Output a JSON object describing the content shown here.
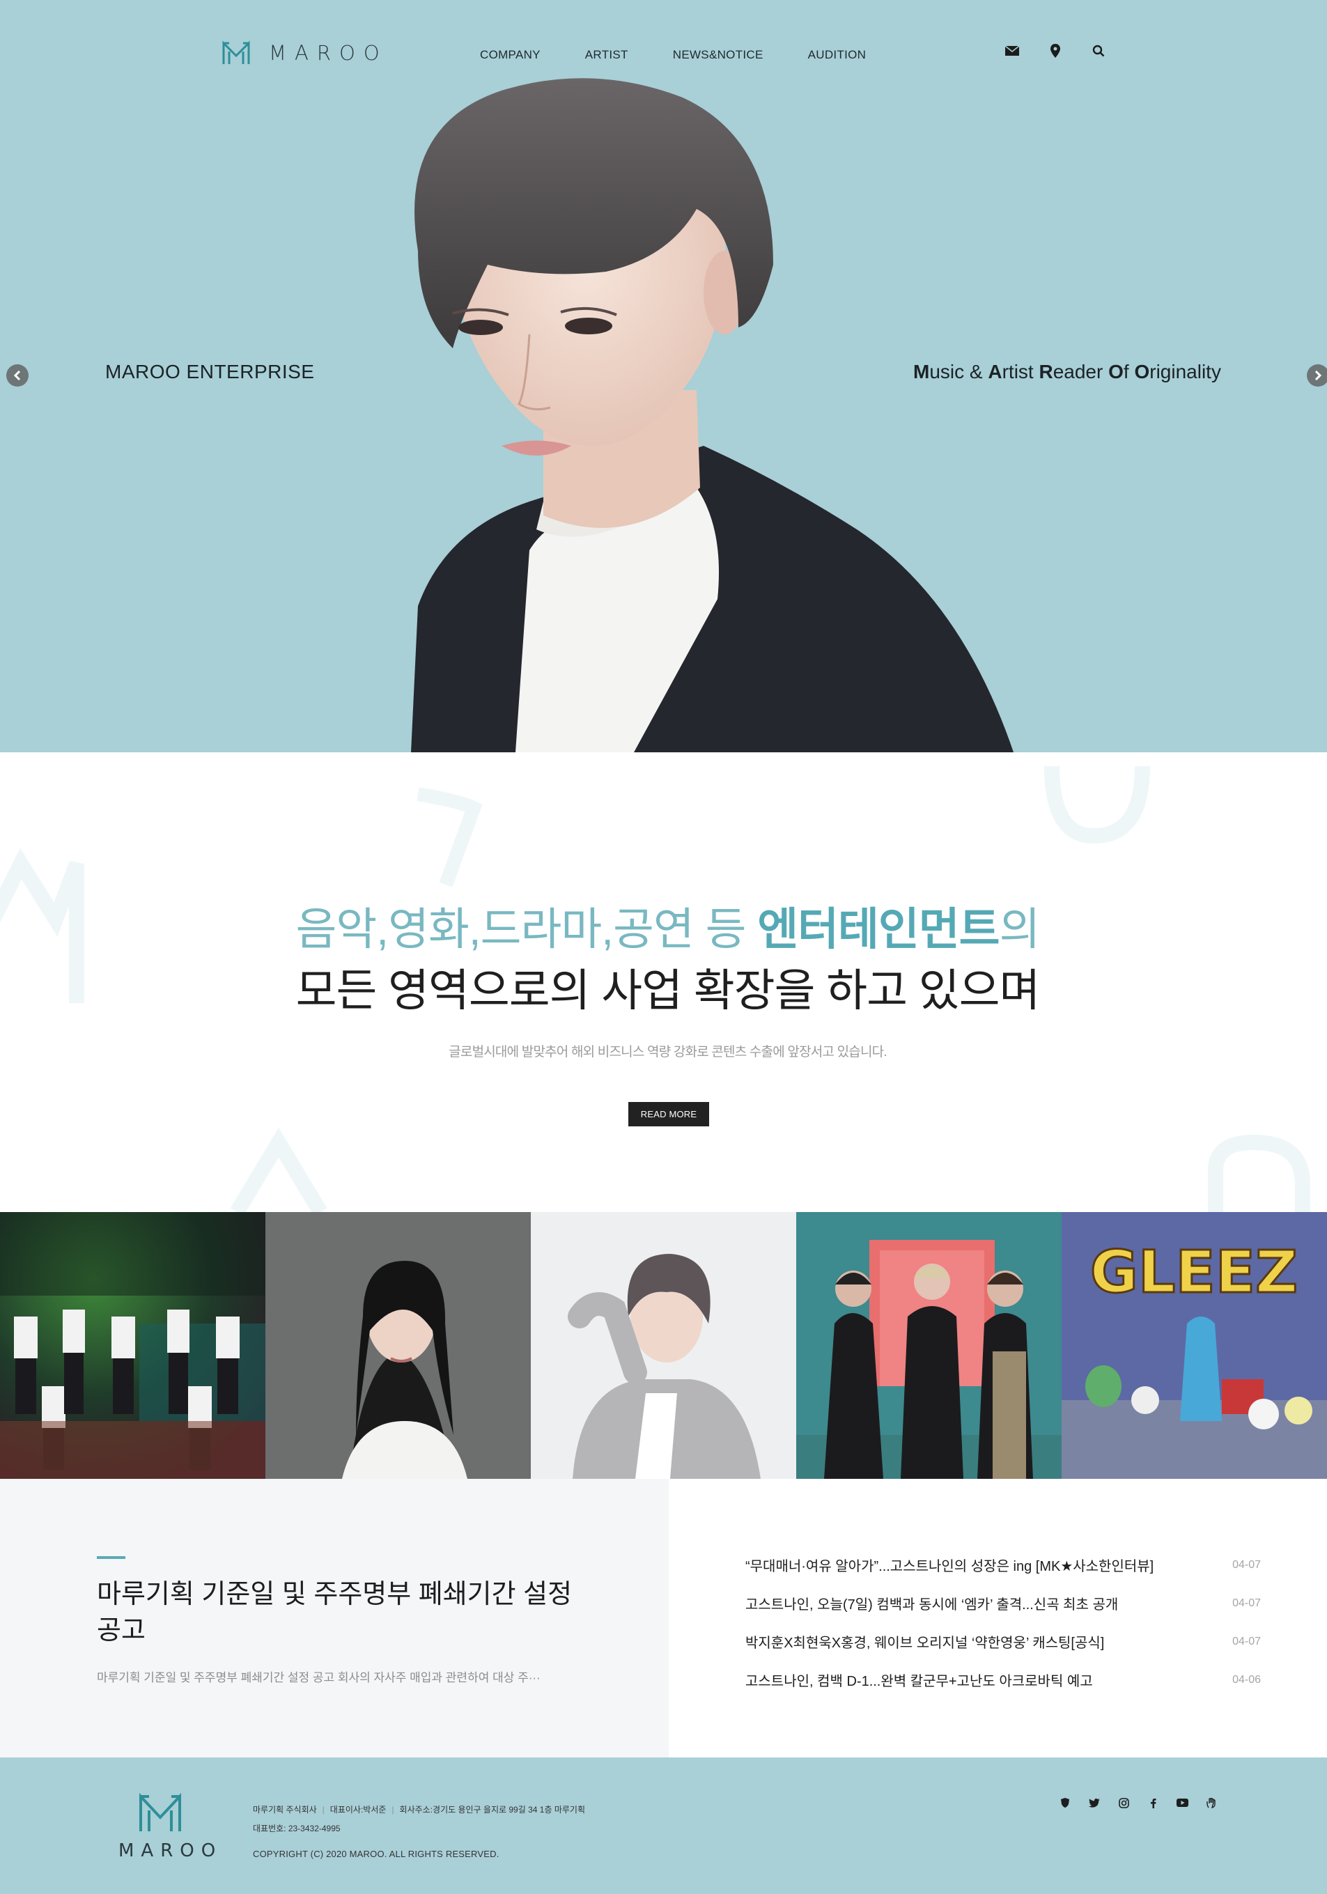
{
  "brand": {
    "logo_text": "MAROO"
  },
  "nav": {
    "items": [
      "COMPANY",
      "ARTIST",
      "NEWS&NOTICE",
      "AUDITION"
    ],
    "icons": [
      "mail-icon",
      "location-pin-icon",
      "search-icon"
    ]
  },
  "hero": {
    "left_text": "MAROO ENTERPRISE",
    "right_text": {
      "parts": [
        {
          "b": "M",
          "t": "usic & "
        },
        {
          "b": "A",
          "t": "rtist "
        },
        {
          "b": "R",
          "t": "eader "
        },
        {
          "b": "O",
          "t": "f "
        },
        {
          "b": "O",
          "t": "riginality"
        }
      ]
    },
    "slides_total": 6,
    "active_slide": 2,
    "background": "#a9cfd7"
  },
  "intro": {
    "line1_prefix": "음악,영화,드라마,공연 등 ",
    "line1_highlight": "엔터테인먼트",
    "line1_suffix": "의",
    "line2": "모든 영역으로의 사업 확장을 하고 있으며",
    "sub": "글로벌시대에 발맞추어 해외 비즈니스 역량 강화로 콘텐츠 수출에 앞장서고 있습니다.",
    "read_more": "READ MORE"
  },
  "gallery": [
    "group-photo-tile",
    "actress-portrait-tile",
    "singer-portrait-tile",
    "trio-photo-tile",
    "gleez-tile"
  ],
  "gallery_texts": {
    "gleez": "GLEEZ"
  },
  "notice": {
    "title": "마루기획 기준일 및 주주명부 폐쇄기간 설정 공고",
    "desc": "마루기획 기준일 및 주주명부 폐쇄기간 설정 공고 회사의 자사주 매입과 관련하여 대상 주···"
  },
  "news": [
    {
      "title": "“무대매너·여유 알아가”...고스트나인의 성장은 ing [MK★사소한인터뷰]",
      "date": "04-07"
    },
    {
      "title": "고스트나인, 오늘(7일) 컴백과 동시에 ‘엠카’ 출격...신곡 최초 공개",
      "date": "04-07"
    },
    {
      "title": "박지훈X최현욱X홍경, 웨이브 오리지널 ‘약한영웅’ 캐스팅[공식]",
      "date": "04-07"
    },
    {
      "title": "고스트나인, 컴백 D-1...완벽 칼군무+고난도 아크로바틱 예고",
      "date": "04-06"
    }
  ],
  "footer": {
    "logo_text": "MAROO",
    "company": "마루기획 주식회사",
    "ceo": "대표이사:박서준",
    "address": "회사주소:경기도 용인구 을지로 99길 34 1층 마루기획",
    "phone": "대표번호: 23-3432-4995",
    "copyright": "COPYRIGHT (C) 2020 MAROO. ALL RIGHTS RESERVED.",
    "social": [
      "shield-icon",
      "twitter-icon",
      "instagram-icon",
      "facebook-icon",
      "youtube-icon",
      "hand-icon"
    ]
  },
  "colors": {
    "accent": "#55a9b5",
    "hero_bg": "#a9cfd7",
    "dark": "#222222"
  }
}
